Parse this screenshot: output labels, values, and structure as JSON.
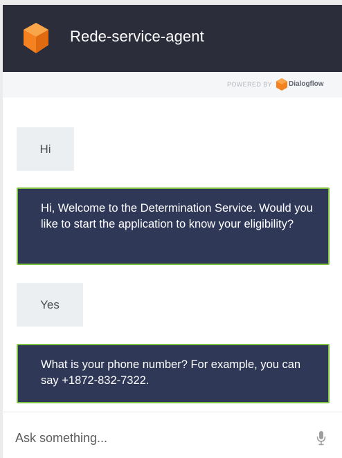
{
  "header": {
    "title": "Rede-service-agent",
    "logo_icon": "cube-logo-icon",
    "background": "#2b2d3b"
  },
  "powered": {
    "label": "POWERED BY",
    "brand": "Dialogflow",
    "brand_icon": "dialogflow-logo-icon"
  },
  "messages": [
    {
      "from": "user",
      "text": "Hi"
    },
    {
      "from": "agent",
      "text": "Hi, Welcome to the Determination Service. Would you like to start the application to know your eligibility?"
    },
    {
      "from": "user",
      "text": "Yes"
    },
    {
      "from": "agent",
      "text": "What is your phone number? For example, you can say +1872-832-7322."
    }
  ],
  "input": {
    "placeholder": "Ask something...",
    "value": "",
    "mic_icon": "microphone-icon"
  },
  "colors": {
    "accent_orange": "#f58220",
    "agent_bubble": "#303858",
    "agent_bubble_border": "#7dc241",
    "user_bubble": "#eceff1"
  }
}
